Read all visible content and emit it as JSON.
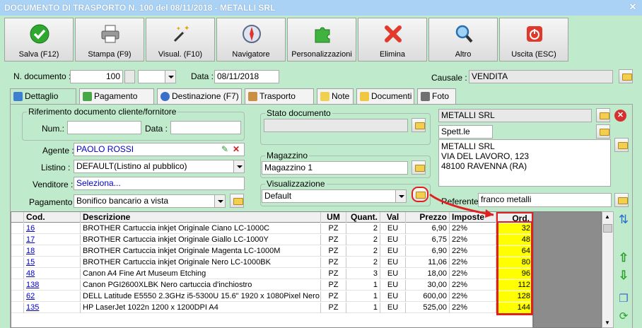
{
  "window": {
    "title": "DOCUMENTO DI TRASPORTO N. 100 del 08/11/2018 - METALLI SRL"
  },
  "toolbar": {
    "buttons": [
      {
        "label": "Salva (F12)",
        "icon": "check-icon"
      },
      {
        "label": "Stampa (F9)",
        "icon": "printer-icon"
      },
      {
        "label": "Visual. (F10)",
        "icon": "magic-wand-icon"
      },
      {
        "label": "Navigatore",
        "icon": "compass-icon"
      },
      {
        "label": "Personalizzazioni",
        "icon": "puzzle-icon"
      },
      {
        "label": "Elimina",
        "icon": "delete-x-icon"
      },
      {
        "label": "Altro",
        "icon": "magnifier-icon"
      },
      {
        "label": "Uscita (ESC)",
        "icon": "power-icon"
      }
    ]
  },
  "header": {
    "ndoc_label": "N. documento :",
    "ndoc_value": "100",
    "data_label": "Data :",
    "data_value": "08/11/2018",
    "causale_label": "Causale :",
    "causale_value": "VENDITA"
  },
  "tabs": [
    {
      "label": "Dettaglio (F5)"
    },
    {
      "label": "Pagamento (F6)"
    },
    {
      "label": "Destinazione (F7)"
    },
    {
      "label": "Trasporto (F8)"
    },
    {
      "label": "Note"
    },
    {
      "label": "Documenti"
    },
    {
      "label": "Foto"
    }
  ],
  "riferimento": {
    "title": "Riferimento documento cliente/fornitore",
    "num_label": "Num.:",
    "data_label": "Data :"
  },
  "fields": {
    "agente_label": "Agente :",
    "agente_value": "PAOLO ROSSI",
    "listino_label": "Listino :",
    "listino_value": "DEFAULT(Listino al pubblico)",
    "venditore_label": "Venditore :",
    "venditore_value": "Seleziona...",
    "pagamento_label": "Pagamento :",
    "pagamento_value": "Bonifico bancario a vista"
  },
  "stato": {
    "title": "Stato documento"
  },
  "magazzino": {
    "title": "Magazzino",
    "value": "Magazzino 1"
  },
  "visualizzazione": {
    "title": "Visualizzazione",
    "value": "Default"
  },
  "cliente": {
    "name": "METALLI SRL",
    "salutation": "Spett.le",
    "address_lines": [
      "METALLI SRL",
      "VIA DEL LAVORO, 123",
      "48100 RAVENNA (RA)"
    ],
    "referente_label": "Referente",
    "referente_value": "franco metalli"
  },
  "grid": {
    "columns": [
      "Cod.",
      "Descrizione",
      "UM",
      "Quant.",
      "Val",
      "Prezzo",
      "Imposte",
      "Ord."
    ],
    "rows": [
      [
        "16",
        "BROTHER Cartuccia inkjet Originale Ciano LC-1000C",
        "PZ",
        "2",
        "EU",
        "6,90",
        "22%",
        "32"
      ],
      [
        "17",
        "BROTHER Cartuccia inkjet Originale Giallo LC-1000Y",
        "PZ",
        "2",
        "EU",
        "6,75",
        "22%",
        "48"
      ],
      [
        "18",
        "BROTHER Cartuccia inkjet Originale Magenta LC-1000M",
        "PZ",
        "2",
        "EU",
        "6,90",
        "22%",
        "64"
      ],
      [
        "15",
        "BROTHER Cartuccia inkjet Originale Nero LC-1000BK",
        "PZ",
        "2",
        "EU",
        "11,06",
        "22%",
        "80"
      ],
      [
        "48",
        "Canon A4 Fine Art Museum Etching",
        "PZ",
        "3",
        "EU",
        "18,00",
        "22%",
        "96"
      ],
      [
        "138",
        "Canon PGI2600XLBK Nero cartuccia d'inchiostro",
        "PZ",
        "1",
        "EU",
        "30,00",
        "22%",
        "112"
      ],
      [
        "62",
        "DELL Latitude E5550 2.3GHz i5-5300U 15.6\" 1920 x 1080Pixel Nero",
        "PZ",
        "1",
        "EU",
        "600,00",
        "22%",
        "128"
      ],
      [
        "135",
        "HP LaserJet 1022n 1200 x 1200DPI A4",
        "PZ",
        "1",
        "EU",
        "525,00",
        "22%",
        "144"
      ]
    ]
  },
  "colors": {
    "title_bar": "#a9d2f5",
    "background": "#bfeacb",
    "highlight": "#ffff00",
    "annotation": "#e02020"
  }
}
